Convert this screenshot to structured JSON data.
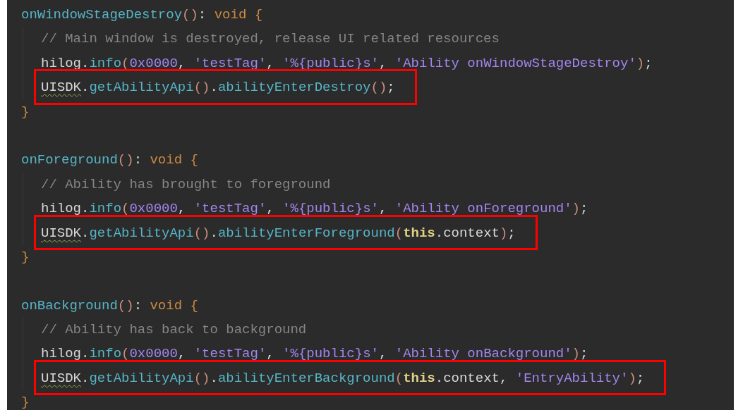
{
  "blocks": [
    {
      "header": [
        {
          "t": "onWindowStageDestroy",
          "kind": "fn"
        },
        {
          "t": "()",
          "kind": "paren"
        },
        {
          "t": ": ",
          "kind": "id"
        },
        {
          "t": "void",
          "kind": "kw"
        },
        {
          "t": " {",
          "kind": "brace"
        }
      ],
      "body": [
        {
          "highlighted": false,
          "tokens": [
            {
              "t": "// Main window is destroyed, release UI related resources",
              "kind": "comment"
            }
          ]
        },
        {
          "highlighted": false,
          "tokens": [
            {
              "t": "hilog",
              "kind": "id"
            },
            {
              "t": ".",
              "kind": "id"
            },
            {
              "t": "info",
              "kind": "fn"
            },
            {
              "t": "(",
              "kind": "paren"
            },
            {
              "t": "0x0000",
              "kind": "str"
            },
            {
              "t": ", ",
              "kind": "id"
            },
            {
              "t": "'testTag'",
              "kind": "str"
            },
            {
              "t": ", ",
              "kind": "id"
            },
            {
              "t": "'%{public}s'",
              "kind": "str"
            },
            {
              "t": ", ",
              "kind": "id"
            },
            {
              "t": "'Ability onWindowStageDestroy'",
              "kind": "str"
            },
            {
              "t": ")",
              "kind": "paren"
            },
            {
              "t": ";",
              "kind": "id"
            }
          ]
        },
        {
          "highlighted": true,
          "tokens": [
            {
              "t": "UISDK",
              "kind": "warn"
            },
            {
              "t": ".",
              "kind": "id"
            },
            {
              "t": "getAbilityApi",
              "kind": "fn"
            },
            {
              "t": "()",
              "kind": "paren"
            },
            {
              "t": ".",
              "kind": "id"
            },
            {
              "t": "abilityEnterDestroy",
              "kind": "fn"
            },
            {
              "t": "()",
              "kind": "paren"
            },
            {
              "t": ";",
              "kind": "id"
            }
          ]
        }
      ],
      "close": "}"
    },
    {
      "header": [
        {
          "t": "onForeground",
          "kind": "fn"
        },
        {
          "t": "()",
          "kind": "paren"
        },
        {
          "t": ": ",
          "kind": "id"
        },
        {
          "t": "void",
          "kind": "kw"
        },
        {
          "t": " {",
          "kind": "brace"
        }
      ],
      "body": [
        {
          "highlighted": false,
          "tokens": [
            {
              "t": "// Ability has brought to foreground",
              "kind": "comment"
            }
          ]
        },
        {
          "highlighted": false,
          "tokens": [
            {
              "t": "hilog",
              "kind": "id"
            },
            {
              "t": ".",
              "kind": "id"
            },
            {
              "t": "info",
              "kind": "fn"
            },
            {
              "t": "(",
              "kind": "paren"
            },
            {
              "t": "0x0000",
              "kind": "str"
            },
            {
              "t": ", ",
              "kind": "id"
            },
            {
              "t": "'testTag'",
              "kind": "str"
            },
            {
              "t": ", ",
              "kind": "id"
            },
            {
              "t": "'%{public}s'",
              "kind": "str"
            },
            {
              "t": ", ",
              "kind": "id"
            },
            {
              "t": "'Ability onForeground'",
              "kind": "str"
            },
            {
              "t": ")",
              "kind": "paren"
            },
            {
              "t": ";",
              "kind": "id"
            }
          ]
        },
        {
          "highlighted": true,
          "tokens": [
            {
              "t": "UISDK",
              "kind": "warn"
            },
            {
              "t": ".",
              "kind": "id"
            },
            {
              "t": "getAbilityApi",
              "kind": "fn"
            },
            {
              "t": "()",
              "kind": "paren"
            },
            {
              "t": ".",
              "kind": "id"
            },
            {
              "t": "abilityEnterForeground",
              "kind": "fn"
            },
            {
              "t": "(",
              "kind": "paren"
            },
            {
              "t": "this",
              "kind": "this"
            },
            {
              "t": ".context",
              "kind": "id"
            },
            {
              "t": ")",
              "kind": "paren"
            },
            {
              "t": ";",
              "kind": "id"
            }
          ]
        }
      ],
      "close": "}"
    },
    {
      "header": [
        {
          "t": "onBackground",
          "kind": "fn"
        },
        {
          "t": "()",
          "kind": "paren"
        },
        {
          "t": ": ",
          "kind": "id"
        },
        {
          "t": "void",
          "kind": "kw"
        },
        {
          "t": " {",
          "kind": "brace"
        }
      ],
      "body": [
        {
          "highlighted": false,
          "tokens": [
            {
              "t": "// Ability has back to background",
              "kind": "comment"
            }
          ]
        },
        {
          "highlighted": false,
          "tokens": [
            {
              "t": "hilog",
              "kind": "id"
            },
            {
              "t": ".",
              "kind": "id"
            },
            {
              "t": "info",
              "kind": "fn"
            },
            {
              "t": "(",
              "kind": "paren"
            },
            {
              "t": "0x0000",
              "kind": "str"
            },
            {
              "t": ", ",
              "kind": "id"
            },
            {
              "t": "'testTag'",
              "kind": "str"
            },
            {
              "t": ", ",
              "kind": "id"
            },
            {
              "t": "'%{public}s'",
              "kind": "str"
            },
            {
              "t": ", ",
              "kind": "id"
            },
            {
              "t": "'Ability onBackground'",
              "kind": "str"
            },
            {
              "t": ")",
              "kind": "paren"
            },
            {
              "t": ";",
              "kind": "id"
            }
          ]
        },
        {
          "highlighted": true,
          "tokens": [
            {
              "t": "UISDK",
              "kind": "warn"
            },
            {
              "t": ".",
              "kind": "id"
            },
            {
              "t": "getAbilityApi",
              "kind": "fn"
            },
            {
              "t": "()",
              "kind": "paren"
            },
            {
              "t": ".",
              "kind": "id"
            },
            {
              "t": "abilityEnterBackground",
              "kind": "fn"
            },
            {
              "t": "(",
              "kind": "paren"
            },
            {
              "t": "this",
              "kind": "this"
            },
            {
              "t": ".context",
              "kind": "id"
            },
            {
              "t": ", ",
              "kind": "id"
            },
            {
              "t": "'EntryAbility'",
              "kind": "str"
            },
            {
              "t": ")",
              "kind": "paren"
            },
            {
              "t": ";",
              "kind": "id"
            }
          ]
        }
      ],
      "close": "}"
    }
  ]
}
